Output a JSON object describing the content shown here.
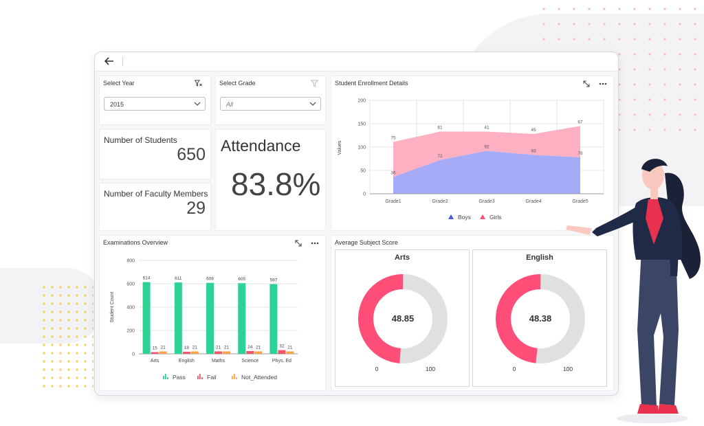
{
  "nav": {
    "back_icon": "arrow-left-icon"
  },
  "filters": {
    "year": {
      "title": "Select Year",
      "value": "2015",
      "icon": "filter-clear-icon"
    },
    "grade": {
      "title": "Select Grade",
      "value": "All",
      "icon": "filter-icon"
    }
  },
  "kpis": {
    "students": {
      "label": "Number of Students",
      "value": "650"
    },
    "faculty": {
      "label": "Number of Faculty Members",
      "value": "29"
    },
    "attendance": {
      "label": "Attendance",
      "value": "83.8%"
    }
  },
  "enrollment": {
    "title": "Student Enrollment Details",
    "icons": [
      "expand-icon",
      "more-icon"
    ],
    "chart_data": {
      "type": "area",
      "stacked": true,
      "categories": [
        "Grade1",
        "Grade2",
        "Grade3",
        "Grade4",
        "Grade5"
      ],
      "series": [
        {
          "name": "Boys",
          "values": [
            36,
            72,
            92,
            83,
            78
          ],
          "color": "#a6abf7"
        },
        {
          "name": "Girls",
          "values": [
            75,
            61,
            41,
            45,
            67
          ],
          "color": "#fdb0c2"
        }
      ],
      "ylabel": "Values",
      "ylim": [
        0,
        200
      ],
      "yticks": [
        0,
        50,
        100,
        150,
        200
      ],
      "grid": true,
      "legend": "bottom"
    }
  },
  "exams": {
    "title": "Examinations Overview",
    "icons": [
      "expand-icon",
      "more-icon"
    ],
    "chart_data": {
      "type": "bar",
      "categories": [
        "Arts",
        "English",
        "Maths",
        "Science",
        "Phys. Ed"
      ],
      "series": [
        {
          "name": "Pass",
          "values": [
            614,
            611,
            608,
            605,
            597
          ],
          "color": "#2ed196"
        },
        {
          "name": "Fail",
          "values": [
            15,
            18,
            21,
            24,
            32
          ],
          "color": "#f2566b"
        },
        {
          "name": "Not_Attended",
          "values": [
            21,
            21,
            21,
            21,
            21
          ],
          "color": "#f9a64a"
        }
      ],
      "ylabel": "Student Count",
      "ylim": [
        0,
        800
      ],
      "yticks": [
        0,
        200,
        400,
        600,
        800
      ],
      "grid": true,
      "legend": "bottom"
    }
  },
  "scores": {
    "title": "Average Subject Score",
    "gauges": [
      {
        "title": "Arts",
        "value": 48.85,
        "label": "48.85",
        "min": "0",
        "max": "100"
      },
      {
        "title": "English",
        "value": 48.38,
        "label": "48.38",
        "min": "0",
        "max": "100"
      }
    ],
    "colors": {
      "fill": "#ff4f79",
      "track": "#e0e0e0"
    }
  }
}
